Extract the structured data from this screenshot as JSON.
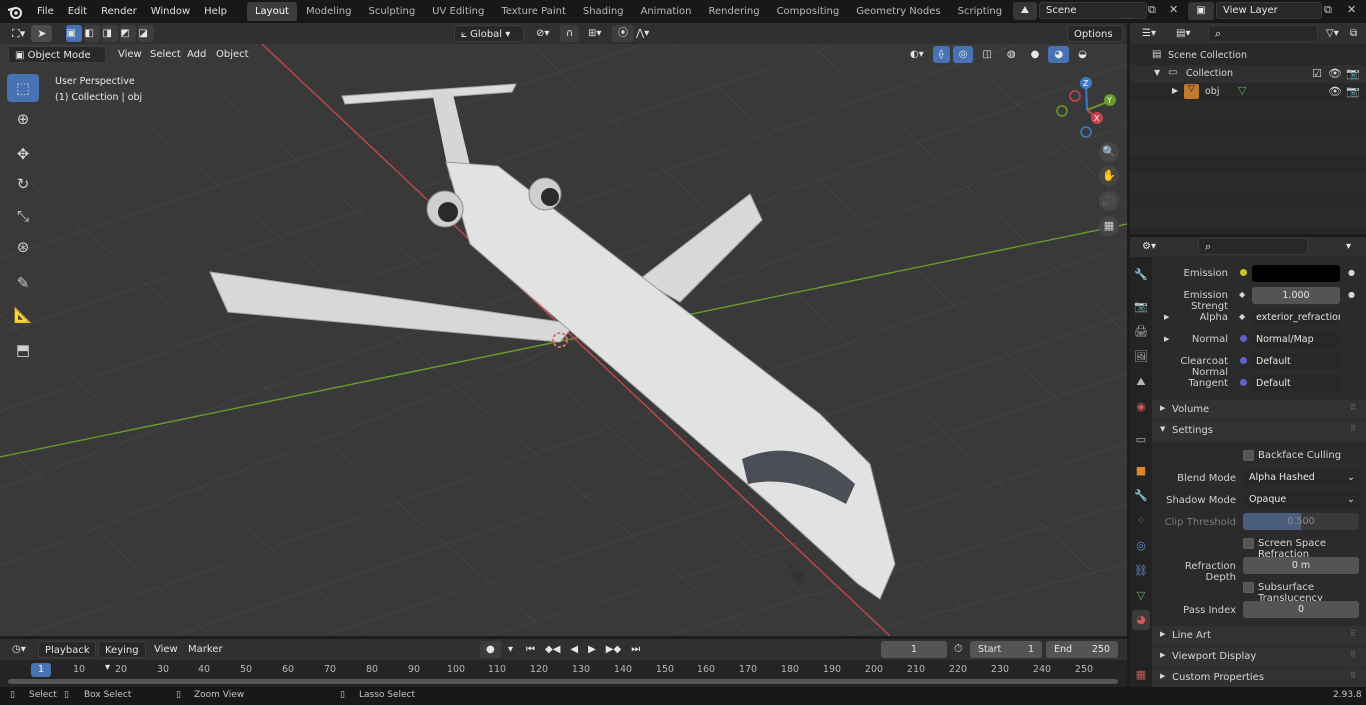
{
  "topbar": {
    "menus": [
      "File",
      "Edit",
      "Render",
      "Window",
      "Help"
    ],
    "workspaces": [
      "Layout",
      "Modeling",
      "Sculpting",
      "UV Editing",
      "Texture Paint",
      "Shading",
      "Animation",
      "Rendering",
      "Compositing",
      "Geometry Nodes",
      "Scripting"
    ],
    "active_workspace": "Layout",
    "add_tab": "+",
    "scene": "Scene",
    "view_layer": "View Layer"
  },
  "viewport_header": {
    "mode": "Object Mode",
    "menus": [
      "View",
      "Select",
      "Add",
      "Object"
    ],
    "orientation": "Global",
    "options": "Options"
  },
  "viewport": {
    "perspective": "User Perspective",
    "collection": "(1) Collection | obj",
    "gizmo": {
      "z": "Z",
      "y": "Y",
      "x": "X"
    }
  },
  "outliner": {
    "scene_collection": "Scene Collection",
    "collection": "Collection",
    "object": "obj"
  },
  "properties": {
    "rows": [
      {
        "label": "Emission",
        "value": ""
      },
      {
        "label": "Emission Strengt",
        "value": "1.000"
      },
      {
        "label": "Alpha",
        "value": "exterior_refraction_i..."
      },
      {
        "label": "Normal",
        "value": "Normal/Map"
      },
      {
        "label": "Clearcoat Normal",
        "value": "Default"
      },
      {
        "label": "Tangent",
        "value": "Default"
      }
    ],
    "volume": "Volume",
    "settings": "Settings",
    "backface_culling": "Backface Culling",
    "blend_mode_label": "Blend Mode",
    "blend_mode": "Alpha Hashed",
    "shadow_mode_label": "Shadow Mode",
    "shadow_mode": "Opaque",
    "clip_threshold_label": "Clip Threshold",
    "clip_threshold": "0.500",
    "clip_fill": 0.5,
    "ssr": "Screen Space Refraction",
    "refraction_depth_label": "Refraction Depth",
    "refraction_depth": "0 m",
    "subsurface": "Subsurface Translucency",
    "pass_index_label": "Pass Index",
    "pass_index": "0",
    "line_art": "Line Art",
    "viewport_display": "Viewport Display",
    "custom_properties": "Custom Properties"
  },
  "timeline": {
    "menus": [
      "Playback",
      "Keying",
      "View",
      "Marker"
    ],
    "current_frame": "1",
    "start_label": "Start",
    "start": "1",
    "end_label": "End",
    "end": "250",
    "ticks": [
      "1",
      "10",
      "20",
      "30",
      "40",
      "50",
      "60",
      "70",
      "80",
      "90",
      "100",
      "110",
      "120",
      "130",
      "140",
      "150",
      "160",
      "170",
      "180",
      "190",
      "200",
      "210",
      "220",
      "230",
      "240",
      "250"
    ]
  },
  "statusbar": {
    "select": "Select",
    "box_select": "Box Select",
    "zoom_view": "Zoom View",
    "lasso_select": "Lasso Select",
    "version": "2.93.8"
  },
  "colors": {
    "accent": "#4772b3",
    "x_axis": "#c4464b",
    "y_axis": "#6a9a2a"
  }
}
